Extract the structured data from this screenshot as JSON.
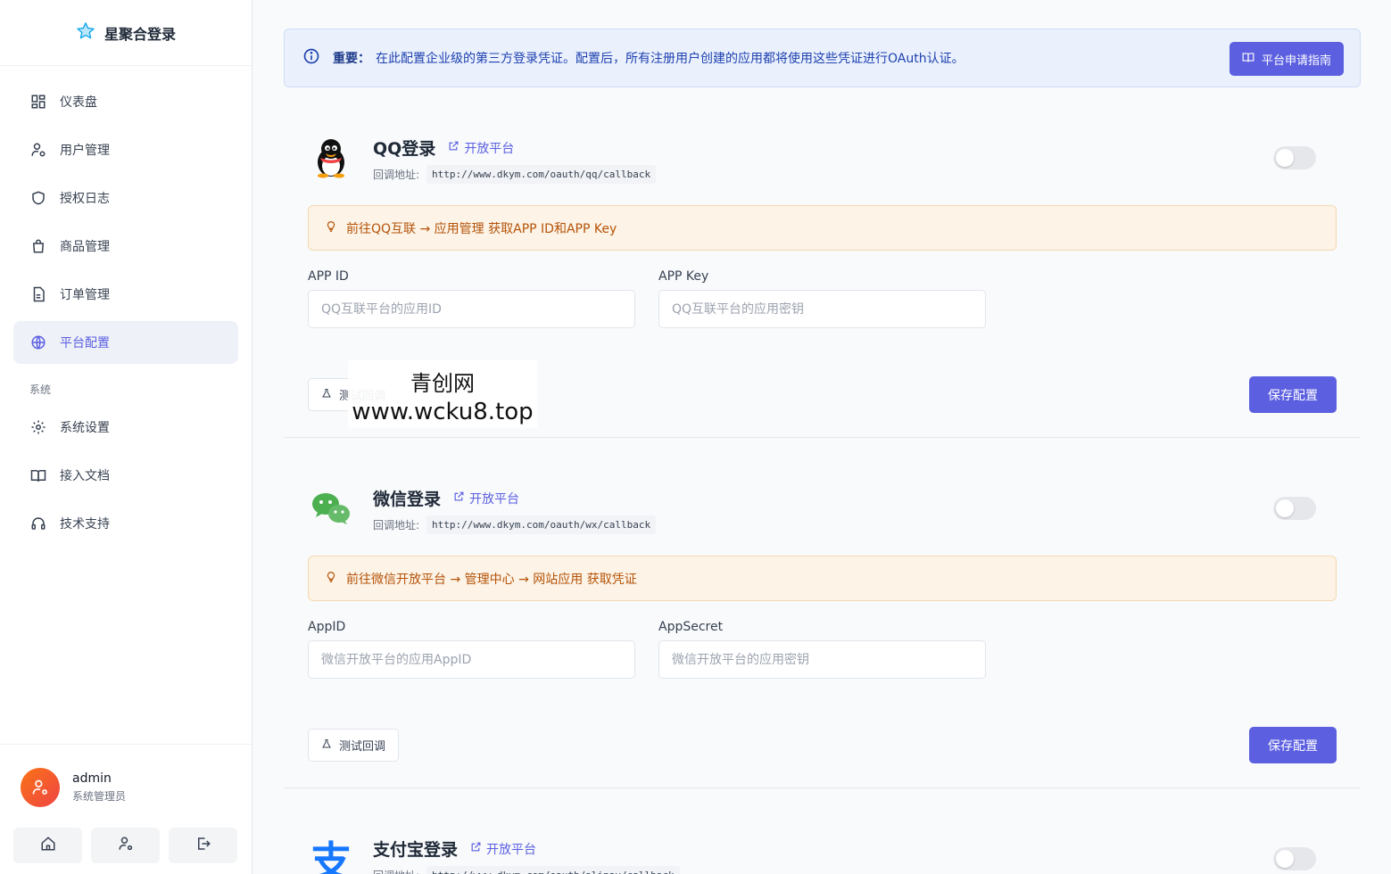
{
  "brand": {
    "name": "星聚合登录"
  },
  "nav": {
    "items": [
      {
        "label": "仪表盘"
      },
      {
        "label": "用户管理"
      },
      {
        "label": "授权日志"
      },
      {
        "label": "商品管理"
      },
      {
        "label": "订单管理"
      },
      {
        "label": "平台配置"
      }
    ],
    "section_label": "系统",
    "system_items": [
      {
        "label": "系统设置"
      },
      {
        "label": "接入文档"
      },
      {
        "label": "技术支持"
      }
    ]
  },
  "user": {
    "name": "admin",
    "role": "系统管理员"
  },
  "notice": {
    "strong": "重要：",
    "text": "在此配置企业级的第三方登录凭证。配置后，所有注册用户创建的应用都将使用这些凭证进行OAuth认证。",
    "guide_label": "平台申请指南"
  },
  "common": {
    "open_platform": "开放平台",
    "callback_label": "回调地址:",
    "test_label": "测试回调",
    "save_label": "保存配置"
  },
  "qq": {
    "title": "QQ登录",
    "callback": "http://www.dkym.com/oauth/qq/callback",
    "tip": "前往QQ互联 → 应用管理 获取APP ID和APP Key",
    "field1_label": "APP ID",
    "field1_placeholder": "QQ互联平台的应用ID",
    "field2_label": "APP Key",
    "field2_placeholder": "QQ互联平台的应用密钥"
  },
  "wx": {
    "title": "微信登录",
    "callback": "http://www.dkym.com/oauth/wx/callback",
    "tip": "前往微信开放平台 → 管理中心 → 网站应用 获取凭证",
    "field1_label": "AppID",
    "field1_placeholder": "微信开放平台的应用AppID",
    "field2_label": "AppSecret",
    "field2_placeholder": "微信开放平台的应用密钥"
  },
  "alipay": {
    "title": "支付宝登录",
    "callback": "http://www.dkym.com/oauth/alipay/callback"
  },
  "watermark": {
    "line1": "青创网",
    "line2": "www.wcku8.top"
  },
  "colors": {
    "accent": "#5b5fe0",
    "tip_bg": "#fdf3e6",
    "notice_bg": "#eaf1fd"
  }
}
